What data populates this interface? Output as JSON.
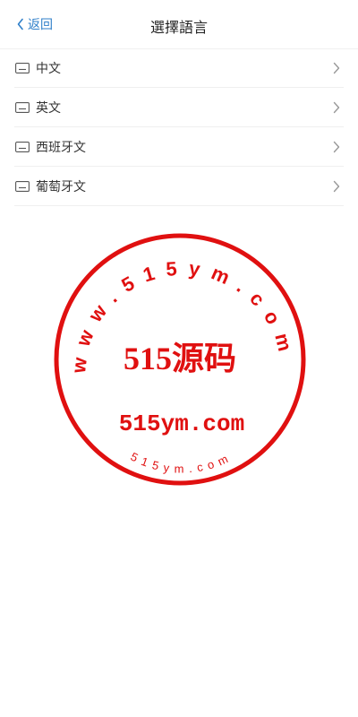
{
  "header": {
    "back_label": "返回",
    "title": "選擇語言"
  },
  "languages": [
    {
      "label": "中文"
    },
    {
      "label": "英文"
    },
    {
      "label": "西班牙文"
    },
    {
      "label": "葡萄牙文"
    }
  ],
  "watermark": {
    "arc_top": "www.515ym.com",
    "center_title": "515源码",
    "center_url": "515ym.com",
    "arc_bottom": "515ym.com",
    "color": "#e01010"
  },
  "colors": {
    "accent": "#2f7fc9",
    "divider": "#efefef"
  }
}
